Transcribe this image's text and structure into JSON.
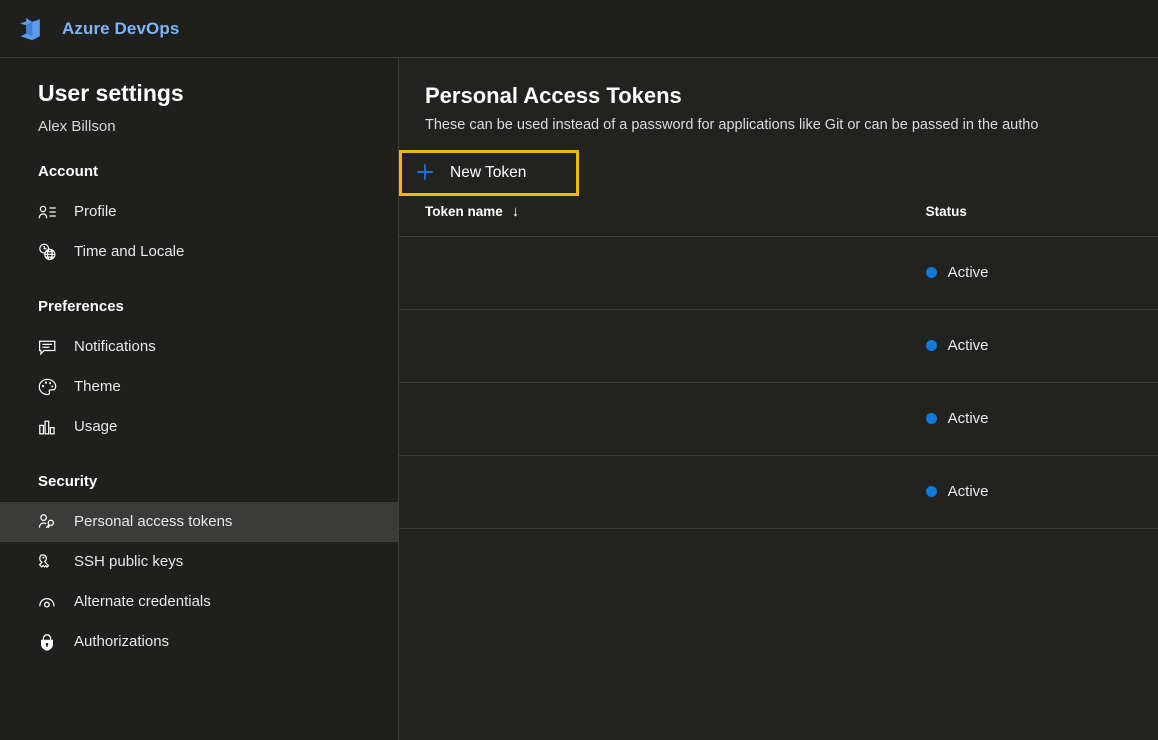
{
  "topbar": {
    "logo_icon": "azure-devops-logo",
    "title": "Azure DevOps",
    "brand_color": "#7eb5f5"
  },
  "sidebar": {
    "heading": "User settings",
    "user_name": "Alex Billson",
    "groups": [
      {
        "label": "Account",
        "items": [
          {
            "label": "Profile",
            "icon": "person-list-icon",
            "selected": false
          },
          {
            "label": "Time and Locale",
            "icon": "clock-globe-icon",
            "selected": false
          }
        ]
      },
      {
        "label": "Preferences",
        "items": [
          {
            "label": "Notifications",
            "icon": "comment-icon",
            "selected": false
          },
          {
            "label": "Theme",
            "icon": "palette-icon",
            "selected": false
          },
          {
            "label": "Usage",
            "icon": "bar-chart-icon",
            "selected": false
          }
        ]
      },
      {
        "label": "Security",
        "items": [
          {
            "label": "Personal access tokens",
            "icon": "person-key-icon",
            "selected": true
          },
          {
            "label": "SSH public keys",
            "icon": "ssh-key-icon",
            "selected": false
          },
          {
            "label": "Alternate credentials",
            "icon": "eye-icon",
            "selected": false
          },
          {
            "label": "Authorizations",
            "icon": "lock-icon",
            "selected": false
          }
        ]
      }
    ]
  },
  "main": {
    "title": "Personal Access Tokens",
    "description": "These can be used instead of a password for applications like Git or can be passed in the autho",
    "new_token_label": "New Token",
    "new_token_icon": "plus-icon",
    "focus_border_color": "#f2b705",
    "plus_color": "#1f6fd0",
    "table": {
      "columns": [
        {
          "label": "Token name",
          "sort_icon": "arrow-down-icon",
          "sorted": true
        },
        {
          "label": "Status",
          "sort_icon": "",
          "sorted": false
        }
      ],
      "status_dot_color": "#0f7ada",
      "rows": [
        {
          "token_name": "",
          "status": "Active"
        },
        {
          "token_name": "",
          "status": "Active"
        },
        {
          "token_name": "",
          "status": "Active"
        },
        {
          "token_name": "",
          "status": "Active"
        }
      ]
    }
  }
}
